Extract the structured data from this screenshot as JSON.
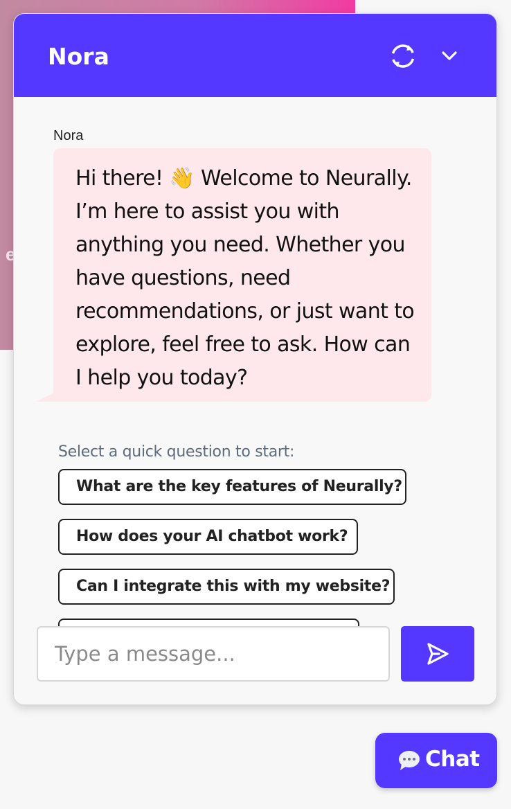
{
  "widget": {
    "title": "Nora",
    "header_icons": [
      "refresh-icon",
      "chevron-down-icon"
    ]
  },
  "conversation": {
    "sender": "Nora",
    "message": "Hi there! 👋 Welcome to Neurally. I’m here to assist you with anything you need. Whether you have questions, need recommendations, or just want to explore, feel free to ask. How can I help you today?"
  },
  "quick_questions": {
    "label": "Select a quick question to start:",
    "items": [
      "What are the key features of Neurally?",
      "How does your AI chatbot work?",
      "Can I integrate this with my website?",
      ""
    ]
  },
  "composer": {
    "placeholder": "Type a message...",
    "value": "",
    "send_icon": "send-icon"
  },
  "launcher": {
    "label": "Chat",
    "icon": "chat-bubble-icon"
  },
  "colors": {
    "primary": "#5538ff",
    "bubble": "#ffe8eb",
    "hero_gradient_end": "#f23aa3"
  }
}
